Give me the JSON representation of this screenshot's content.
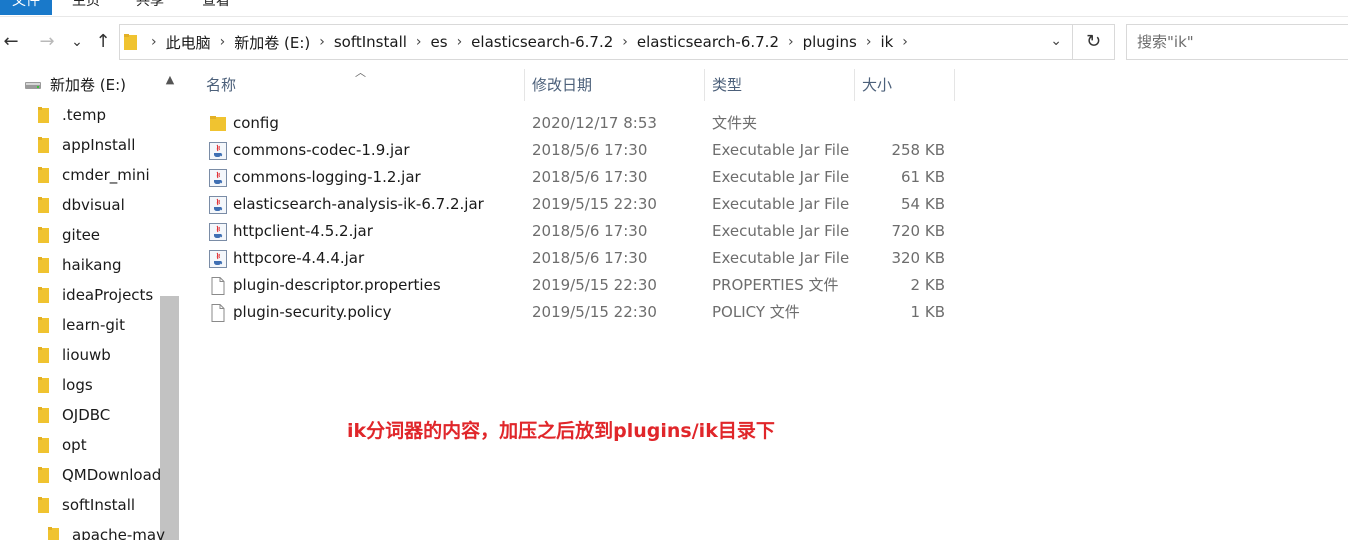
{
  "ribbon": {
    "tabs": [
      "文件",
      "主页",
      "共享",
      "查看"
    ]
  },
  "nav_buttons": {
    "back": "←",
    "forward": "→",
    "recent": "⌄",
    "up": "↑"
  },
  "address": {
    "crumbs": [
      "此电脑",
      "新加卷 (E:)",
      "softInstall",
      "es",
      "elasticsearch-6.7.2",
      "elasticsearch-6.7.2",
      "plugins",
      "ik"
    ],
    "chevron": "›",
    "dropdown": "⌄",
    "refresh": "↻"
  },
  "search": {
    "placeholder": "搜索\"ik\""
  },
  "nav_pane": {
    "drive": "新加卷 (E:)",
    "folders": [
      ".temp",
      "appInstall",
      "cmder_mini",
      "dbvisual",
      "gitee",
      "haikang",
      "ideaProjects",
      "learn-git",
      "liouwb",
      "logs",
      "OJDBC",
      "opt",
      "QMDownload",
      "softInstall"
    ],
    "sub_folder": "apache-mav"
  },
  "columns": {
    "name": "名称",
    "date": "修改日期",
    "type": "类型",
    "size": "大小"
  },
  "files": [
    {
      "icon": "folder-icon",
      "name": "config",
      "date": "2020/12/17 8:53",
      "type": "文件夹",
      "size": ""
    },
    {
      "icon": "jar-icon",
      "name": "commons-codec-1.9.jar",
      "date": "2018/5/6 17:30",
      "type": "Executable Jar File",
      "size": "258 KB"
    },
    {
      "icon": "jar-icon",
      "name": "commons-logging-1.2.jar",
      "date": "2018/5/6 17:30",
      "type": "Executable Jar File",
      "size": "61 KB"
    },
    {
      "icon": "jar-icon",
      "name": "elasticsearch-analysis-ik-6.7.2.jar",
      "date": "2019/5/15 22:30",
      "type": "Executable Jar File",
      "size": "54 KB"
    },
    {
      "icon": "jar-icon",
      "name": "httpclient-4.5.2.jar",
      "date": "2018/5/6 17:30",
      "type": "Executable Jar File",
      "size": "720 KB"
    },
    {
      "icon": "jar-icon",
      "name": "httpcore-4.4.4.jar",
      "date": "2018/5/6 17:30",
      "type": "Executable Jar File",
      "size": "320 KB"
    },
    {
      "icon": "file-icon",
      "name": "plugin-descriptor.properties",
      "date": "2019/5/15 22:30",
      "type": "PROPERTIES 文件",
      "size": "2 KB"
    },
    {
      "icon": "file-icon",
      "name": "plugin-security.policy",
      "date": "2019/5/15 22:30",
      "type": "POLICY 文件",
      "size": "1 KB"
    }
  ],
  "annotation": "ik分词器的内容，加压之后放到plugins/ik目录下",
  "colors": {
    "folder": "#f0c330",
    "annotation": "#e0262a",
    "accent": "#1979ca"
  }
}
